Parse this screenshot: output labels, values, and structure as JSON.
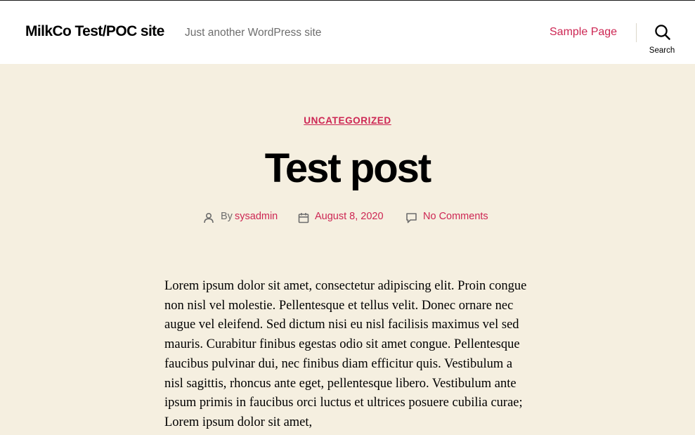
{
  "header": {
    "site_title": "MilkCo Test/POC site",
    "tagline": "Just another WordPress site",
    "nav": [
      {
        "label": "Sample Page"
      }
    ],
    "search_label": "Search"
  },
  "post": {
    "category": "UNCATEGORIZED",
    "title": "Test post",
    "meta": {
      "author_prefix": "By",
      "author": "sysadmin",
      "date": "August 8, 2020",
      "comments": "No Comments"
    },
    "body": "Lorem ipsum dolor sit amet, consectetur adipiscing elit. Proin congue non nisl vel molestie. Pellentesque et tellus velit. Donec ornare nec augue vel eleifend. Sed dictum nisi eu nisl facilisis maximus vel sed mauris. Curabitur finibus egestas odio sit amet congue. Pellentesque faucibus pulvinar dui, nec finibus diam efficitur quis. Vestibulum a nisl sagittis, rhoncus ante eget, pellentesque libero. Vestibulum ante ipsum primis in faucibus orci luctus et ultrices posuere cubilia curae; Lorem ipsum dolor sit amet,"
  },
  "colors": {
    "accent": "#cd2653",
    "background": "#f5efe0",
    "header_bg": "#ffffff",
    "meta_text": "#6d6d6d"
  },
  "icons": [
    "search-icon",
    "author-icon",
    "calendar-icon",
    "comment-icon"
  ]
}
